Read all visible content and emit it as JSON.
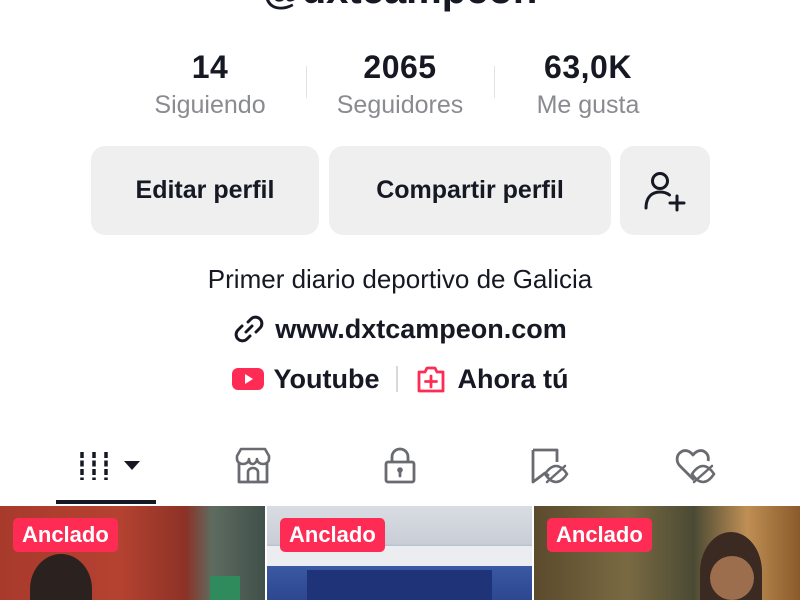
{
  "profile": {
    "handle": "@dxtcampeon",
    "bio": "Primer diario deportivo de Galicia",
    "website": "www.dxtcampeon.com"
  },
  "stats": [
    {
      "value": "14",
      "label": "Siguiendo"
    },
    {
      "value": "2065",
      "label": "Seguidores"
    },
    {
      "value": "63,0K",
      "label": "Me gusta"
    }
  ],
  "buttons": {
    "edit_profile": "Editar perfil",
    "share_profile": "Compartir perfil",
    "add_friend_icon": "person-plus-icon"
  },
  "social_links": [
    {
      "label": "Youtube",
      "icon": "youtube-icon"
    },
    {
      "label": "Ahora tú",
      "icon": "add-square-icon"
    }
  ],
  "tabs": [
    {
      "icon": "videos-grid-icon",
      "active": true
    },
    {
      "icon": "shop-icon",
      "active": false
    },
    {
      "icon": "private-lock-icon",
      "active": false
    },
    {
      "icon": "favorites-hidden-icon",
      "active": false
    },
    {
      "icon": "liked-hidden-icon",
      "active": false
    }
  ],
  "videos": [
    {
      "badge": "Anclado"
    },
    {
      "badge": "Anclado"
    },
    {
      "badge": "Anclado"
    }
  ],
  "colors": {
    "accent": "#fe2c55",
    "text": "#161823",
    "muted": "#8a8b91",
    "button_bg": "#efefef"
  }
}
